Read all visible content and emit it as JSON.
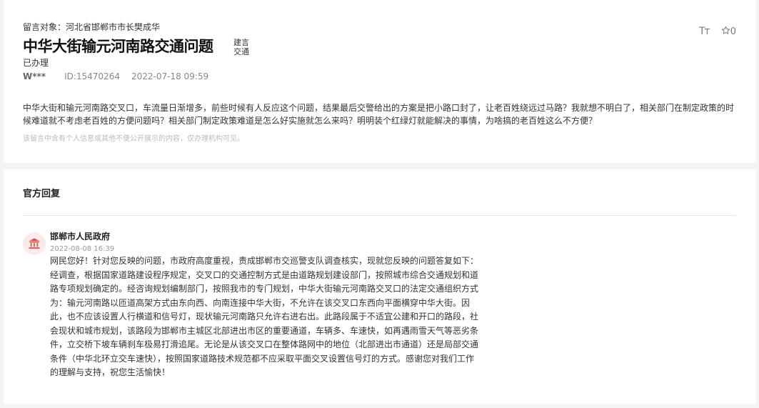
{
  "message": {
    "target_label": "留言对象：",
    "target": "河北省邯郸市市长樊成华",
    "title": "中华大街输元河南路交通问题",
    "category": "建言交通",
    "status": "已办理",
    "author": "W***",
    "id_label": "ID:15470264",
    "datetime": "2022-07-18 09:59",
    "font_tool": "Tт",
    "star_count": "0",
    "content": "中华大街和输元河南路交叉口，车流量日渐增多，前些时候有人反应这个问题，结果最后交警给出的方案是把小路口封了，让老百姓绕远过马路？我就想不明白了，相关部门在制定政策的时候难道就不考虑老百姓的方便问题吗？相关部门制定政策难道是怎么好实施就怎么来吗？明明装个红绿灯就能解决的事情，为啥搞的老百姓这么不方便？",
    "privacy_note": "该留言中含有个人信息或其他不便公开展示的内容，仅办理机构可见。"
  },
  "reply": {
    "section_title": "官方回复",
    "org": "邯郸市人民政府",
    "datetime": "2022-08-08 16:39",
    "content": "网民您好！针对您反映的问题，市政府高度重视，责成邯郸市交巡警支队调查核实，现就您反映的问题答复如下：经调查，根据国家道路建设程序规定，交叉口的交通控制方式是由道路规划建设部门，按照城市综合交通规划和道路专项规划确定的。经咨询规划编制部门，按照我市的专门规划，中华大街输元河南路交叉口的法定交通组织方式为：输元河南路以匝道高架方式由东向西、向南连接中华大街，不允许在该交叉口东西向平面横穿中华大街。因此，也不应该设置人行横道和信号灯，现状输元河南路只允许右进右出。此路段属于不适宜公建和开口的路段，社会现状和城市规划，该路段为邯郸市主城区北部进出市区的重要通道，车辆多、车速快，如再遇雨雪天气等恶劣条件，立交桥下坡车辆刹车极易打滑追尾。无论是从该交叉口在整体路网中的地位（北部进出市通道）还是局部交通条件（中华北环立交车速快），按照国家道路技术规范都不应采取平面交叉设置信号灯的方式。感谢您对我们工作的理解与支持，祝您生活愉快！"
  },
  "colors": {
    "background": "#f4f4f4",
    "card": "#ffffff",
    "avatar_bg": "#fdeaea",
    "avatar_icon": "#d9534f"
  },
  "icons": {
    "font_size": "font-size-icon",
    "star": "star-icon",
    "government": "government-building-icon"
  }
}
